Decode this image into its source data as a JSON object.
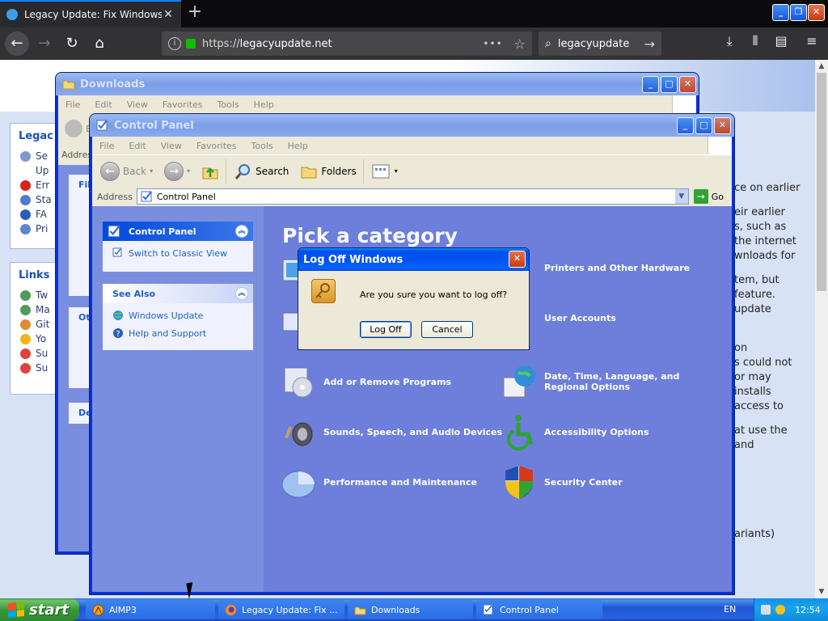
{
  "browser": {
    "tab_title": "Legacy Update: Fix Windows Upda",
    "url_prefix": "https://",
    "url_host": "legacyupdate.net",
    "search_text": "legacyupdate",
    "url_dots": "•••"
  },
  "webpage": {
    "sidebar_heading1": "Legac",
    "sidebar_items1": [
      "Se",
      "Up",
      "Err",
      "Sta",
      "FA",
      "Pri"
    ],
    "sidebar_heading2": "Links",
    "sidebar_items2": [
      "Tw",
      "Ma",
      "Git",
      "Yo",
      "Su",
      "Su"
    ],
    "text_lines": [
      "ce on earlier",
      "eir earlier",
      "s, such as",
      " the internet",
      "wnloads for",
      "tem, but",
      " feature.",
      "update",
      " on",
      "s could not",
      " or may",
      " installs",
      "access to",
      "at use the",
      " and",
      "ariants)"
    ]
  },
  "downloads_window": {
    "title": "Downloads",
    "menu": [
      "File",
      "Edit",
      "View",
      "Favorites",
      "Tools",
      "Help"
    ],
    "partial_address": "Addres",
    "partial_back": "B",
    "partial_tasks": [
      "File",
      "Oth",
      "De"
    ]
  },
  "control_panel": {
    "title": "Control Panel",
    "menu": [
      "File",
      "Edit",
      "View",
      "Favorites",
      "Tools",
      "Help"
    ],
    "toolbar": {
      "back": "Back",
      "search": "Search",
      "folders": "Folders"
    },
    "address_label": "Address",
    "address_value": "Control Panel",
    "go_label": "Go",
    "heading": "Pick a category",
    "left_pane": {
      "cp_title": "Control Panel",
      "switch_link": "Switch to Classic View",
      "see_also_title": "See Also",
      "see_also_links": [
        "Windows Update",
        "Help and Support"
      ]
    },
    "categories": [
      "Printers and Other Hardware",
      "User Accounts",
      "Add or Remove Programs",
      "Date, Time, Language, and Regional Options",
      "Sounds, Speech, and Audio Devices",
      "Accessibility Options",
      "Performance and Maintenance",
      "Security Center"
    ]
  },
  "logoff_dialog": {
    "title": "Log Off Windows",
    "message": "Are you sure you want to log off?",
    "ok_label": "Log Off",
    "cancel_label": "Cancel"
  },
  "taskbar": {
    "start_label": "start",
    "items": [
      "AIMP3",
      "Legacy Update: Fix ...",
      "Downloads",
      "Control Panel"
    ],
    "language": "EN",
    "clock": "12:54"
  },
  "colors": {
    "xp_blue": "#0053ee",
    "cp_background": "#6d7fda",
    "start_green": "#389838",
    "firefox_dark": "#323234"
  }
}
